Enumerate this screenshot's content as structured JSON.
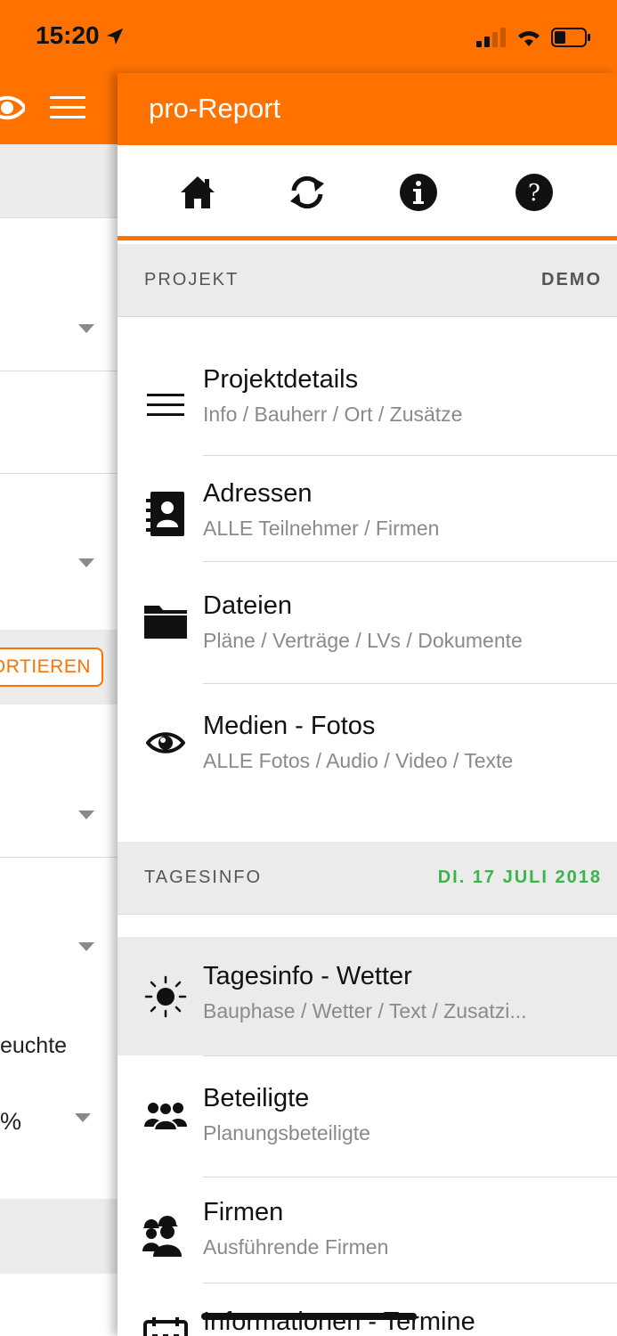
{
  "status": {
    "time": "15:20"
  },
  "background_screen": {
    "import_button": "ORTIEREN",
    "partial_text_1": "euchte",
    "partial_text_2": "%"
  },
  "drawer": {
    "title": "pro-Report",
    "toolbar": [
      {
        "icon": "home-icon"
      },
      {
        "icon": "sync-icon"
      },
      {
        "icon": "info-icon"
      },
      {
        "icon": "help-icon"
      }
    ],
    "project_section": {
      "label": "PROJEKT",
      "value": "DEMO"
    },
    "project_items": [
      {
        "icon": "menu-lines-icon",
        "title": "Projektdetails",
        "subtitle": "Info / Bauherr / Ort / Zusätze"
      },
      {
        "icon": "address-book-icon",
        "title": "Adressen",
        "subtitle": "ALLE Teilnehmer / Firmen"
      },
      {
        "icon": "folder-icon",
        "title": "Dateien",
        "subtitle": "Pläne / Verträge / LVs / Dokumente"
      },
      {
        "icon": "eye-icon",
        "title": "Medien - Fotos",
        "subtitle": "ALLE Fotos / Audio / Video / Texte"
      }
    ],
    "day_section": {
      "label": "TAGESINFO",
      "value": "DI. 17 JULI 2018",
      "value_color": "#3bb54a"
    },
    "day_items": [
      {
        "icon": "sun-icon",
        "title": "Tagesinfo - Wetter",
        "subtitle": "Bauphase / Wetter / Text / Zusatzi...",
        "active": true
      },
      {
        "icon": "participants-icon",
        "title": "Beteiligte",
        "subtitle": "Planungsbeteiligte"
      },
      {
        "icon": "workers-icon",
        "title": "Firmen",
        "subtitle": "Ausführende Firmen"
      },
      {
        "icon": "calendar-icon",
        "title": "Informationen - Termine",
        "subtitle": ""
      }
    ]
  },
  "colors": {
    "accent": "#ff7200",
    "section_bg": "#ebebeb",
    "date_green": "#3bb54a"
  }
}
